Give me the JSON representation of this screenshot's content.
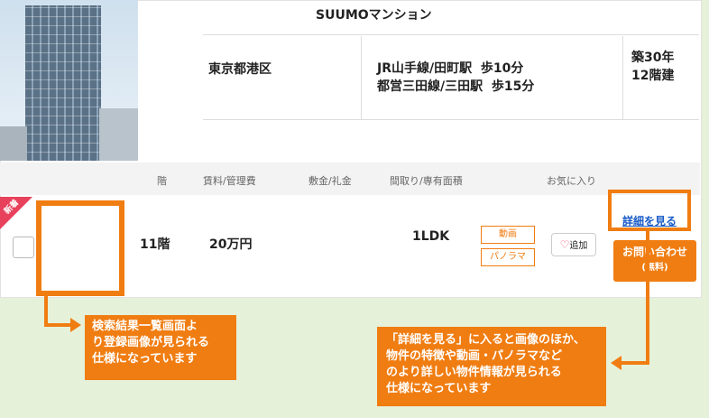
{
  "property": {
    "name": "SUUMOマンション",
    "address": "東京都港区",
    "access": [
      "JR山手線/田町駅  歩10分",
      "都営三田線/三田駅  歩15分"
    ],
    "age": "築30年",
    "floors": "12階建"
  },
  "table": {
    "headers": {
      "floor": "階",
      "rent": "賃料/管理費",
      "deposit": "敷金/礼金",
      "layout": "間取り/専有面積",
      "favorite": "お気に入り"
    },
    "row": {
      "badge": "新着",
      "floor": "11階",
      "rent": "20万円",
      "layout": "1LDK",
      "tags": [
        "動画",
        "パノラマ"
      ],
      "favorite_label": "追加",
      "detail_link": "詳細を見る",
      "contact_label": "お問い合わせ",
      "contact_sub": "(無料)"
    }
  },
  "callouts": {
    "left": [
      "検索結果一覧画面よ",
      "り登録画像が見られる",
      "仕様になっています"
    ],
    "right": [
      "「詳細を見る」に入ると画像のほか、",
      "物件の特徴や動画・パノラマなど",
      "のより詳しい物件情報が見られる",
      "仕様になっています"
    ]
  },
  "colors": {
    "accent": "#f07d12",
    "link": "#1a5cc8",
    "badge": "#e8415c",
    "background": "#e6f1d9"
  }
}
